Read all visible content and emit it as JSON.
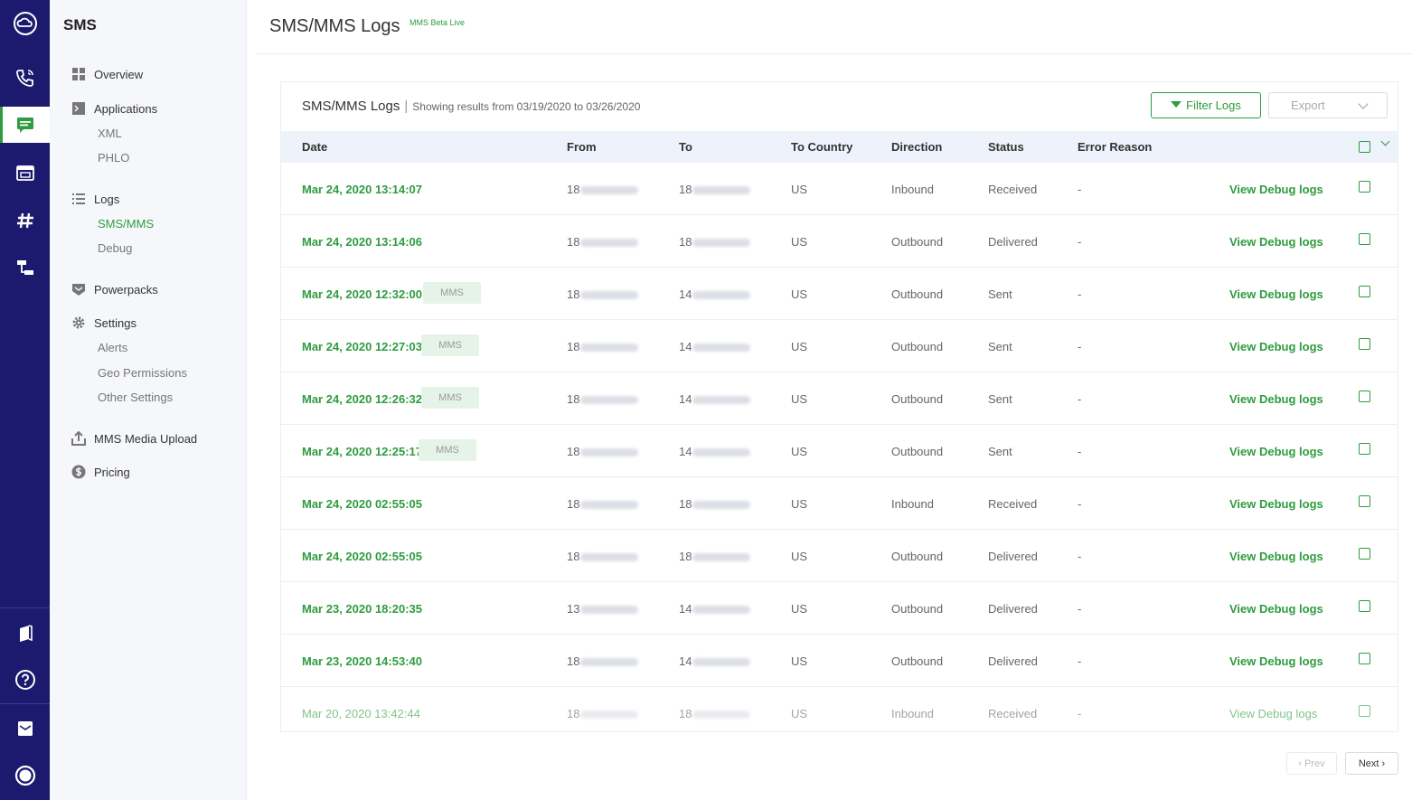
{
  "sidebar": {
    "title": "SMS",
    "items": [
      {
        "label": "Overview"
      },
      {
        "label": "Applications"
      },
      {
        "label": "XML"
      },
      {
        "label": "PHLO"
      },
      {
        "label": "Logs"
      },
      {
        "label": "SMS/MMS"
      },
      {
        "label": "Debug"
      },
      {
        "label": "Powerpacks"
      },
      {
        "label": "Settings"
      },
      {
        "label": "Alerts"
      },
      {
        "label": "Geo Permissions"
      },
      {
        "label": "Other Settings"
      },
      {
        "label": "MMS Media Upload"
      },
      {
        "label": "Pricing"
      }
    ]
  },
  "header": {
    "title": "SMS/MMS Logs",
    "beta": "MMS Beta Live"
  },
  "card": {
    "title": "SMS/MMS Logs",
    "separator": "|",
    "subtitle": "Showing results from 03/19/2020 to 03/26/2020",
    "filter_label": "Filter Logs",
    "export_label": "Export"
  },
  "table": {
    "columns": [
      "Date",
      "From",
      "To",
      "To Country",
      "Direction",
      "Status",
      "Error Reason"
    ],
    "rows": [
      {
        "date": "Mar 24, 2020 13:14:07",
        "mms": "",
        "from": "18",
        "to": "18",
        "country": "US",
        "direction": "Inbound",
        "status": "Received",
        "error": "-",
        "action": "View Debug logs"
      },
      {
        "date": "Mar 24, 2020 13:14:06",
        "mms": "",
        "from": "18",
        "to": "18",
        "country": "US",
        "direction": "Outbound",
        "status": "Delivered",
        "error": "-",
        "action": "View Debug logs"
      },
      {
        "date": "Mar 24, 2020 12:32:00",
        "mms": "MMS",
        "from": "18",
        "to": "14",
        "country": "US",
        "direction": "Outbound",
        "status": "Sent",
        "error": "-",
        "action": "View Debug logs"
      },
      {
        "date": "Mar 24, 2020 12:27:03",
        "mms": "MMS",
        "from": "18",
        "to": "14",
        "country": "US",
        "direction": "Outbound",
        "status": "Sent",
        "error": "-",
        "action": "View Debug logs"
      },
      {
        "date": "Mar 24, 2020 12:26:32",
        "mms": "MMS",
        "from": "18",
        "to": "14",
        "country": "US",
        "direction": "Outbound",
        "status": "Sent",
        "error": "-",
        "action": "View Debug logs"
      },
      {
        "date": "Mar 24, 2020 12:25:17",
        "mms": "MMS",
        "from": "18",
        "to": "14",
        "country": "US",
        "direction": "Outbound",
        "status": "Sent",
        "error": "-",
        "action": "View Debug logs"
      },
      {
        "date": "Mar 24, 2020 02:55:05",
        "mms": "",
        "from": "18",
        "to": "18",
        "country": "US",
        "direction": "Inbound",
        "status": "Received",
        "error": "-",
        "action": "View Debug logs"
      },
      {
        "date": "Mar 24, 2020 02:55:05",
        "mms": "",
        "from": "18",
        "to": "18",
        "country": "US",
        "direction": "Outbound",
        "status": "Delivered",
        "error": "-",
        "action": "View Debug logs"
      },
      {
        "date": "Mar 23, 2020 18:20:35",
        "mms": "",
        "from": "13",
        "to": "14",
        "country": "US",
        "direction": "Outbound",
        "status": "Delivered",
        "error": "-",
        "action": "View Debug logs"
      },
      {
        "date": "Mar 23, 2020 14:53:40",
        "mms": "",
        "from": "18",
        "to": "14",
        "country": "US",
        "direction": "Outbound",
        "status": "Delivered",
        "error": "-",
        "action": "View Debug logs"
      },
      {
        "date": "Mar 20, 2020 13:42:44",
        "mms": "",
        "from": "18",
        "to": "18",
        "country": "US",
        "direction": "Inbound",
        "status": "Received",
        "error": "-",
        "action": "View Debug logs"
      }
    ]
  },
  "pagination": {
    "prev": "Prev",
    "next": "Next"
  },
  "colors": {
    "accent": "#2e9c3f",
    "rail": "#1b1a6e",
    "header_bg": "#edf2fb"
  }
}
